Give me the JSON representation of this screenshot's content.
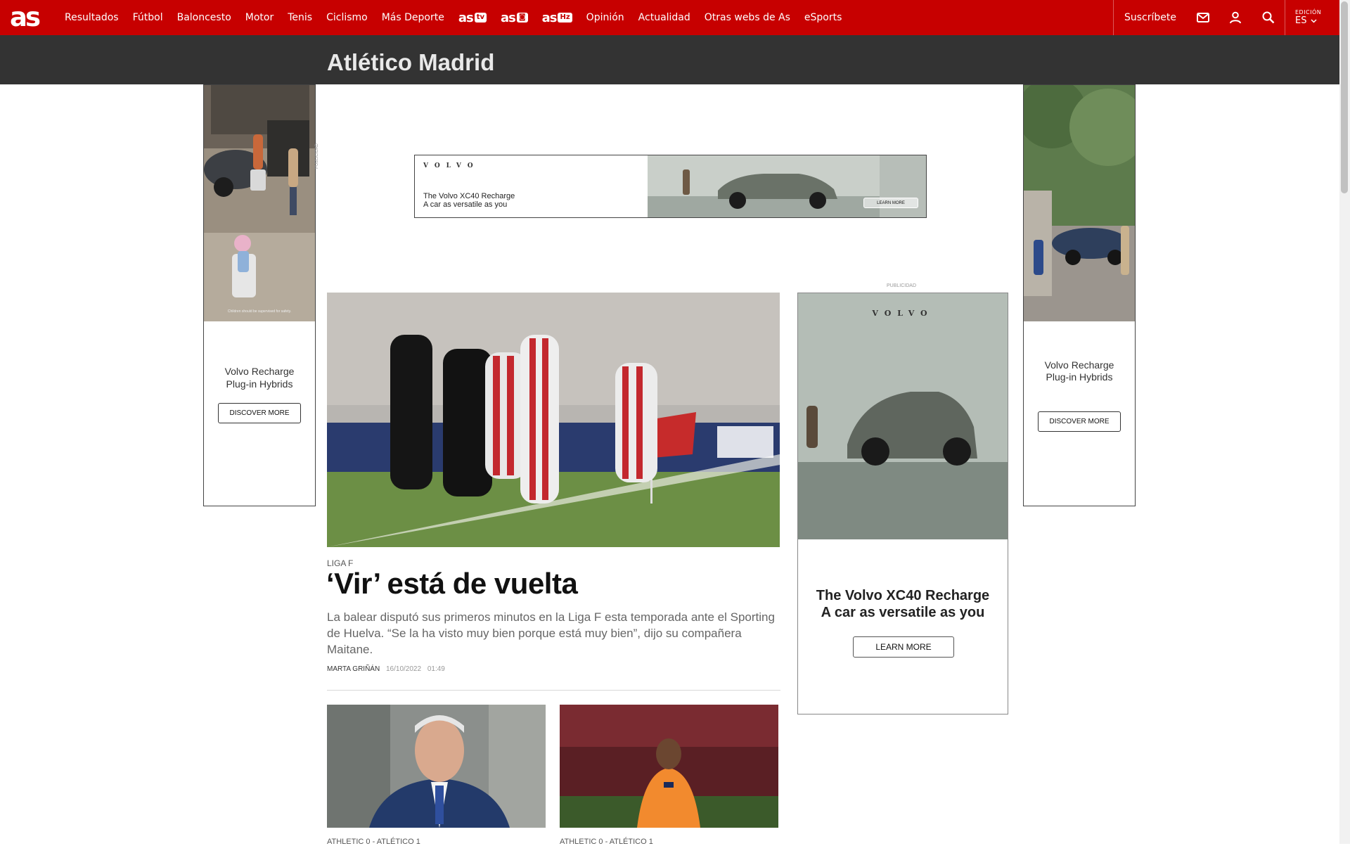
{
  "header": {
    "logo": "as",
    "nav": [
      "Resultados",
      "Fútbol",
      "Baloncesto",
      "Motor",
      "Tenis",
      "Ciclismo",
      "Más Deporte"
    ],
    "brands": [
      {
        "text": "as",
        "badge": "tv"
      },
      {
        "text": "as",
        "badge": "◙"
      },
      {
        "text": "as",
        "badge": "Hz"
      }
    ],
    "nav2": [
      "Opinión",
      "Actualidad",
      "Otras webs de As",
      "eSports"
    ],
    "subscribe": "Suscríbete",
    "edition_label": "EDICIÓN",
    "edition_value": "ES"
  },
  "section": {
    "title": "Atlético Madrid"
  },
  "ads": {
    "publicidad": "PUBLICIDAD",
    "brand": "VOLVO",
    "left": {
      "line1": "Volvo Recharge",
      "line2": "Plug-in Hybrids",
      "button": "DISCOVER MORE",
      "note": "Children should be supervised for safety."
    },
    "right": {
      "line1": "Volvo Recharge",
      "line2": "Plug-in Hybrids",
      "button": "DISCOVER MORE"
    },
    "banner": {
      "line1": "The Volvo XC40 Recharge",
      "line2": "A car as versatile as you",
      "button": "LEARN MORE"
    },
    "side": {
      "line1": "The Volvo XC40 Recharge",
      "line2": "A car as versatile as you",
      "button": "LEARN MORE"
    }
  },
  "article": {
    "kicker": "LIGA F",
    "headline": "‘Vir’ está de vuelta",
    "summary": "La balear disputó sus primeros minutos en la Liga F esta temporada ante el Sporting de Huelva. “Se la ha visto muy bien porque está muy bien”, dijo su compañera Maitane.",
    "author": "MARTA GRIÑÁN",
    "date": "16/10/2022",
    "time": "01:49"
  },
  "thumbs": [
    {
      "kicker": "ATHLETIC 0 - ATLÉTICO 1"
    },
    {
      "kicker": "ATHLETIC 0 - ATLÉTICO 1"
    }
  ],
  "colors": {
    "brand_red": "#c70000",
    "section_bar": "#333333"
  }
}
